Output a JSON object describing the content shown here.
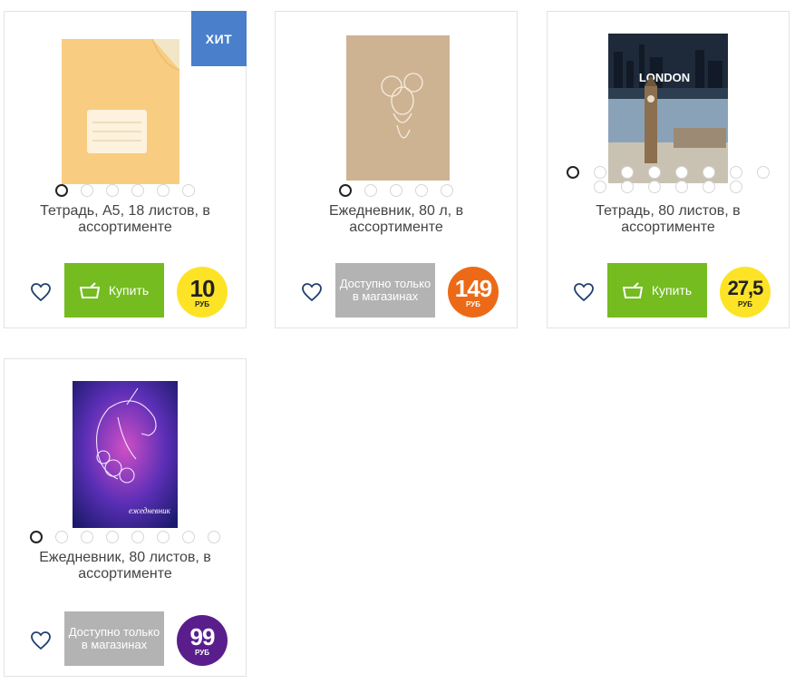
{
  "products": [
    {
      "title": "Тетрадь, А5, 18 листов, в ассортименте",
      "badge": "ХИТ",
      "price": "10",
      "currency": "РУБ",
      "price_color": "#fde326",
      "action": "Купить",
      "dots_total": 6,
      "active_dot": 0
    },
    {
      "title": "Ежедневник, 80 л, в ассортименте",
      "price": "149",
      "currency": "РУБ",
      "price_color": "#ec6a17",
      "action": "Доступно только в магазинах",
      "dots_total": 5,
      "active_dot": 0
    },
    {
      "title": "Тетрадь, 80 листов, в ассортименте",
      "cover_text": "LONDON",
      "price": "27,5",
      "currency": "РУБ",
      "price_color": "#fde326",
      "action": "Купить",
      "dots_total": 14,
      "active_dot": 0
    },
    {
      "title": "Ежедневник, 80 листов, в ассортименте",
      "cover_text": "ежедневник",
      "price": "99",
      "currency": "РУБ",
      "price_color": "#5a1e8c",
      "action": "Доступно только в магазинах",
      "dots_total": 8,
      "active_dot": 0
    }
  ],
  "icons": {
    "favorite": "heart-icon",
    "cart": "basket-icon"
  }
}
